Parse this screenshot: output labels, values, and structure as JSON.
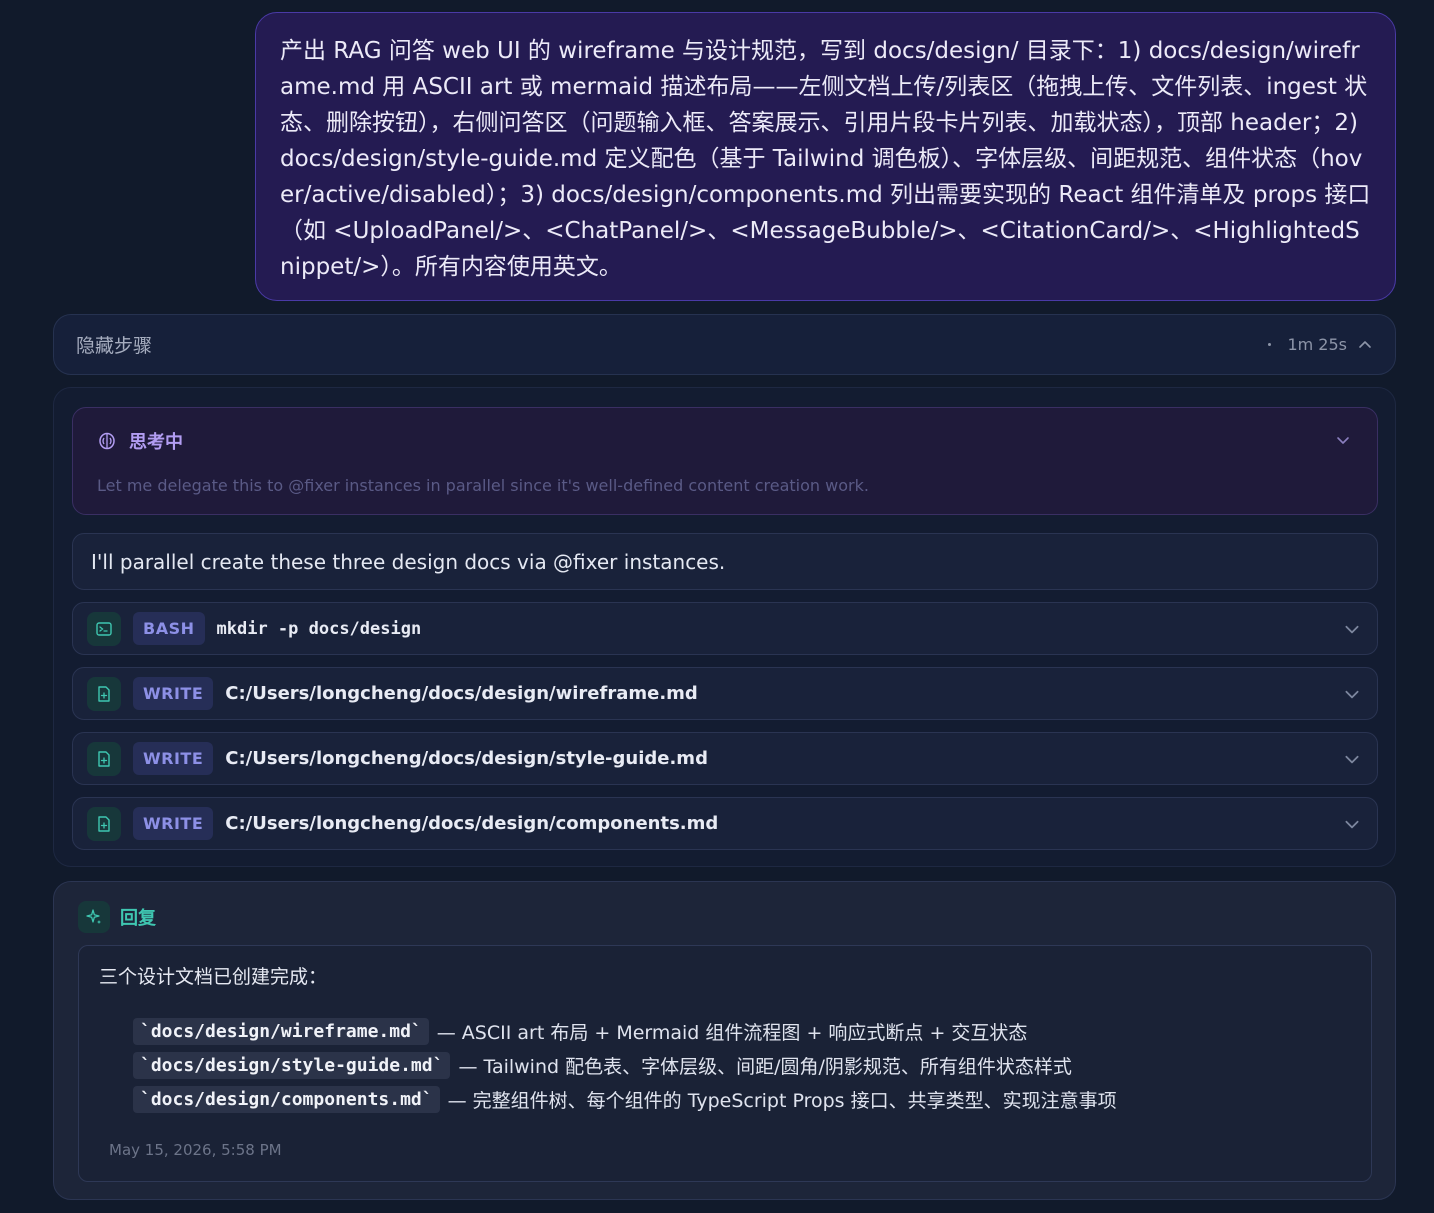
{
  "user_message": "产出 RAG 问答 web UI 的 wireframe 与设计规范，写到 docs/design/ 目录下：1) docs/design/wireframe.md 用 ASCII art 或 mermaid 描述布局——左侧文档上传/列表区（拖拽上传、文件列表、ingest 状态、删除按钮），右侧问答区（问题输入框、答案展示、引用片段卡片列表、加载状态），顶部 header；2) docs/design/style-guide.md 定义配色（基于 Tailwind 调色板）、字体层级、间距规范、组件状态（hover/active/disabled）；3) docs/design/components.md 列出需要实现的 React 组件清单及 props 接口（如 <UploadPanel/>、<ChatPanel/>、<MessageBubble/>、<CitationCard/>、<HighlightedSnippet/>）。所有内容使用英文。",
  "steps": {
    "label": "隐藏步骤",
    "duration": "1m 25s"
  },
  "thinking": {
    "label": "思考中",
    "text": "Let me delegate this to @fixer instances in parallel since it's well-defined content creation work."
  },
  "parallel_message": "I'll parallel create these three design docs via @fixer instances.",
  "tools": [
    {
      "tag": "BASH",
      "command": "mkdir -p docs/design",
      "icon": "terminal-icon"
    },
    {
      "tag": "WRITE",
      "command": "C:/Users/longcheng/docs/design/wireframe.md",
      "icon": "file-plus-icon"
    },
    {
      "tag": "WRITE",
      "command": "C:/Users/longcheng/docs/design/style-guide.md",
      "icon": "file-plus-icon"
    },
    {
      "tag": "WRITE",
      "command": "C:/Users/longcheng/docs/design/components.md",
      "icon": "file-plus-icon"
    }
  ],
  "reply": {
    "label": "回复",
    "intro": "三个设计文档已创建完成：",
    "items": [
      {
        "code": "`docs/design/wireframe.md`",
        "desc": "— ASCII art 布局 + Mermaid 组件流程图 + 响应式断点 + 交互状态"
      },
      {
        "code": "`docs/design/style-guide.md`",
        "desc": "— Tailwind 配色表、字体层级、间距/圆角/阴影规范、所有组件状态样式"
      },
      {
        "code": "`docs/design/components.md`",
        "desc": "— 完整组件树、每个组件的 TypeScript Props 接口、共享类型、实现注意事项"
      }
    ],
    "timestamp": "May 15, 2026, 5:58 PM"
  },
  "colors": {
    "background": "#111a2b",
    "user_bubble": "#241b52",
    "thinking_accent": "#b29df2",
    "reply_accent": "#3fc7b1",
    "tool_tag": "#8d90e6"
  }
}
